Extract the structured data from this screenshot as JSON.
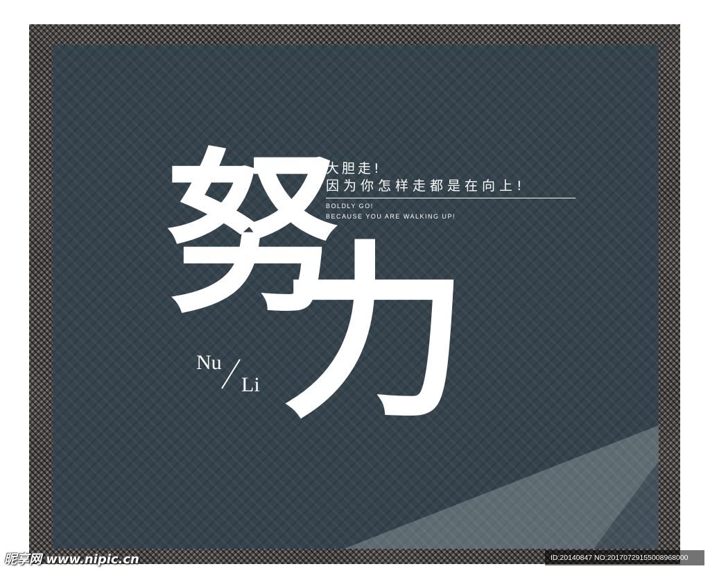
{
  "poster": {
    "main_char_1": "努",
    "main_char_2": "力",
    "slogan_cn_line1": "大胆走!",
    "slogan_cn_line2": "因为你怎样走都是在向上!",
    "slogan_en_line1": "BOLDLY GO!",
    "slogan_en_line2": "BECAUSE YOU ARE WALKING UP!",
    "pinyin_1": "Nu",
    "pinyin_2": "Li"
  },
  "watermark": {
    "site_text": "昵享网 www.nipic.cn",
    "id_text": "ID:20140847 NO:20170729155008968000"
  },
  "colors": {
    "panel": "#34434c",
    "frame": "#4a4644",
    "text": "#ffffff"
  }
}
